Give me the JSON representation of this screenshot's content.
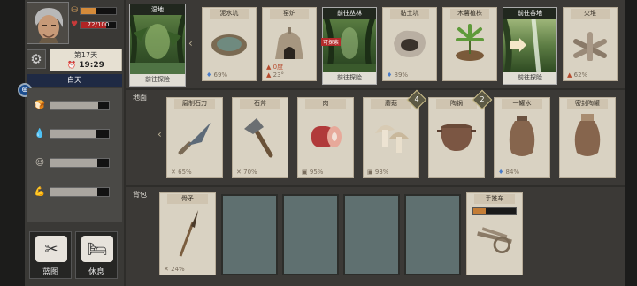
{
  "player": {
    "hp_text": "72/100",
    "stamina_fraction": 0.45,
    "hp_fraction": 0.72
  },
  "calendar": {
    "day": "第17天",
    "time": "19:29"
  },
  "daytime": "白天",
  "needs": [
    {
      "icon": "food-icon",
      "fraction": 0.82
    },
    {
      "icon": "water-icon",
      "fraction": 0.78
    },
    {
      "icon": "mood-icon",
      "fraction": 0.8
    },
    {
      "icon": "strength-icon",
      "fraction": 0.8
    }
  ],
  "left_buttons": [
    {
      "label": "蓝图",
      "icon": "blueprint-icon"
    },
    {
      "label": "休息",
      "icon": "rest-icon"
    }
  ],
  "locations": {
    "current": {
      "title": "湿地",
      "footer": "前往探险"
    },
    "forest": {
      "title": "前往丛林",
      "footer": "前往探险",
      "tag": "可探索"
    },
    "valley": {
      "title": "前往谷地",
      "footer": "前往探险"
    }
  },
  "row1_cards": [
    {
      "title": "泥水坑",
      "meta": "69%",
      "meta_icon": "water-drop-icon"
    },
    {
      "title": "窑炉",
      "meta": "23°",
      "meta2": "0度",
      "meta_icon": "fire-icon"
    },
    {
      "title": "黏土坑",
      "meta": "89%",
      "meta_icon": "water-drop-icon"
    },
    {
      "title": "木薯植株"
    },
    {
      "title": "火堆",
      "meta": "62%",
      "meta_icon": "fire-icon"
    }
  ],
  "ground_label": "地面",
  "row2_cards": [
    {
      "title": "磨制石刀",
      "meta": "65%",
      "meta_icon": "tool-icon"
    },
    {
      "title": "石斧",
      "meta": "70%",
      "meta_icon": "tool-icon"
    },
    {
      "title": "肉",
      "meta": "95%",
      "meta_icon": "freshness-icon"
    },
    {
      "title": "蘑菇",
      "meta": "93%",
      "meta_icon": "freshness-icon",
      "badge": "4"
    },
    {
      "title": "陶锅",
      "badge": "2"
    },
    {
      "title": "一罐水",
      "meta": "84%",
      "meta_icon": "water-drop-icon"
    },
    {
      "title": "密封陶罐"
    }
  ],
  "backpack_label": "背包",
  "backpack_cards": [
    {
      "title": "骨矛",
      "meta": "24%",
      "meta_icon": "tool-icon"
    },
    {
      "title": "手推车"
    }
  ]
}
